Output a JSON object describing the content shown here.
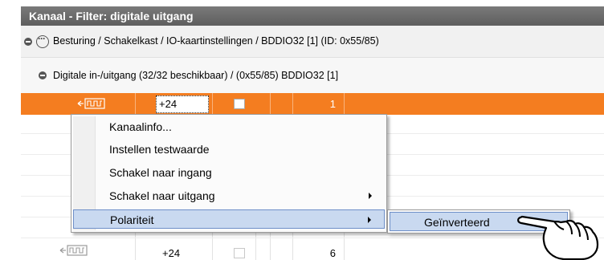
{
  "window": {
    "title": "Kanaal - Filter: digitale uitgang"
  },
  "breadcrumb": {
    "text": "Besturing  / Schakelkast  / IO-kaartinstellingen  / BDDIO32 [1] (ID: 0x55/85)"
  },
  "subheader": {
    "text": "Digitale in-/uitgang (32/32 beschikbaar)  /  (0x55/85) BDDIO32 [1]"
  },
  "rows": {
    "selected": {
      "icon": "output-pulse-icon",
      "value": "+24",
      "checked": false,
      "number": "1"
    },
    "last": {
      "icon": "output-pulse-icon",
      "value": "+24",
      "checked": false,
      "number": "6"
    }
  },
  "context_menu": {
    "items": [
      {
        "label": "Kanaalinfo..."
      },
      {
        "label": "Instellen testwaarde"
      },
      {
        "label": "Schakel naar ingang"
      },
      {
        "label": "Schakel naar uitgang"
      },
      {
        "label": "Polariteit"
      }
    ],
    "active_item": "Polariteit"
  },
  "submenu": {
    "items": [
      {
        "label": "Geïnverteerd"
      }
    ]
  },
  "cursor": {
    "icon": "pointing-hand-cursor-icon"
  },
  "colors": {
    "selection": "#f47d20",
    "menu_highlight": "#c9d9f0",
    "title_bar": "#6b6b6b"
  }
}
